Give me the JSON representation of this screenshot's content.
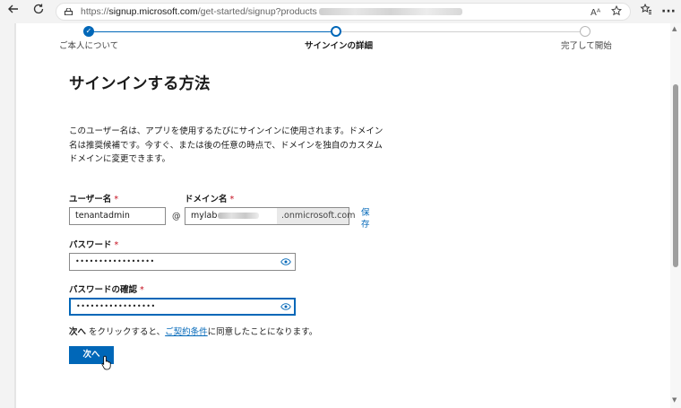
{
  "browser": {
    "url_prefix": "https://",
    "url_host": "signup.microsoft.com",
    "url_path": "/get-started/signup?products",
    "icons": [
      "back-arrow-icon",
      "refresh-icon",
      "lock-icon",
      "read-aloud-icon",
      "favorite-star-icon",
      "favorites-icon",
      "more-icon"
    ],
    "read_aloud_glyph": "Aᴬ",
    "more_glyph": "···"
  },
  "stepper": {
    "steps": [
      {
        "label": "ご本人について",
        "state": "done"
      },
      {
        "label": "サインインの詳細",
        "state": "current"
      },
      {
        "label": "完了して開始",
        "state": "todo"
      }
    ]
  },
  "page": {
    "title": "サインインする方法",
    "description": "このユーザー名は、アプリを使用するたびにサインインに使用されます。ドメイン名は推奨候補です。今すぐ、または後の任意の時点で、ドメインを独自のカスタム ドメインに変更できます。"
  },
  "form": {
    "username_label": "ユーザー名",
    "username_value": "tenantadmin",
    "at_sign": "@",
    "domain_label": "ドメイン名",
    "domain_value": "mylab",
    "domain_suffix": ".onmicrosoft.com",
    "save_link": "保存",
    "required_mark": "*",
    "password_label": "パスワード",
    "password_value": "•••••••••••••••••",
    "confirm_label": "パスワードの確認",
    "confirm_value": "•••••••••••••••••"
  },
  "agreement": {
    "prefix_bold": "次へ",
    "middle": " をクリックすると、",
    "link": "ご契約条件",
    "suffix": "に同意したことになります。"
  },
  "next_button": "次へ",
  "colors": {
    "accent": "#0067b8",
    "required": "#c50f1f",
    "chrome": "#f3f3f3"
  }
}
